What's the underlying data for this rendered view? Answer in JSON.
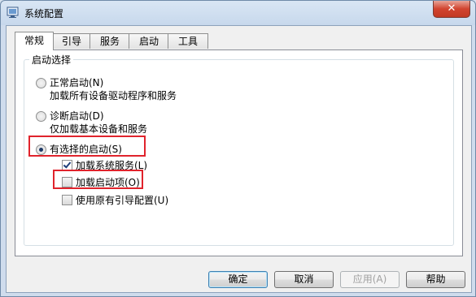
{
  "window": {
    "title": "系统配置",
    "close_label": "✕"
  },
  "tabs": [
    "常规",
    "引导",
    "服务",
    "启动",
    "工具"
  ],
  "group": {
    "title": "启动选择"
  },
  "options": {
    "normal": {
      "label": "正常启动(N)",
      "desc": "加载所有设备驱动程序和服务"
    },
    "diagnostic": {
      "label": "诊断启动(D)",
      "desc": "仅加载基本设备和服务"
    },
    "selective": {
      "label": "有选择的启动(S)"
    }
  },
  "checks": {
    "load_services": {
      "label": "加载系统服务(L)",
      "checked": true
    },
    "load_startup": {
      "label": "加载启动项(O)",
      "checked": false
    },
    "use_original_boot": {
      "label": "使用原有引导配置(U)",
      "checked": false
    }
  },
  "buttons": {
    "ok": "确定",
    "cancel": "取消",
    "apply": "应用(A)",
    "help": "帮助"
  },
  "colors": {
    "highlight": "#e0232c",
    "radio_dot": "#1e3a66"
  }
}
